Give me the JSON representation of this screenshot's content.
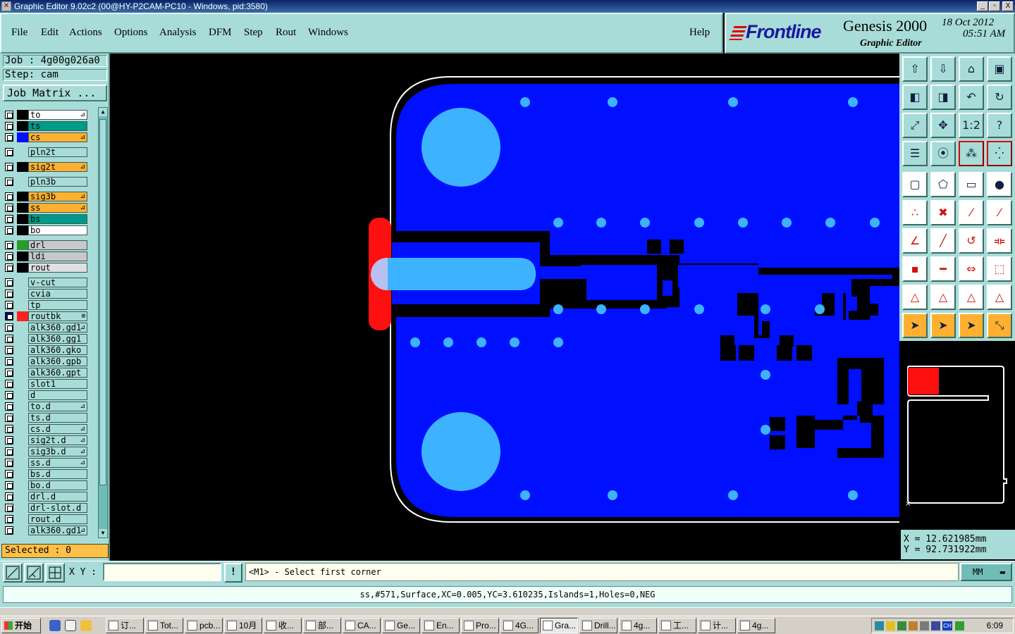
{
  "window": {
    "title": "Graphic Editor 9.02c2 (00@HY-P2CAM-PC10 - Windows, pid:3580)",
    "controls": [
      "_",
      "▫",
      "X"
    ]
  },
  "menu": {
    "items": [
      "File",
      "Edit",
      "Actions",
      "Options",
      "Analysis",
      "DFM",
      "Step",
      "Rout",
      "Windows"
    ],
    "help": "Help"
  },
  "brand": {
    "logo": "Frontline",
    "product": "Genesis 2000",
    "subtitle": "Graphic Editor",
    "date": "18 Oct 2012",
    "time": "05:51 AM"
  },
  "job": {
    "job_text": "Job : 4g00g026a0",
    "step_text": "Step: cam",
    "matrix_label": "Job Matrix ..."
  },
  "layers": [
    {
      "name": "to",
      "color": "#ffffff",
      "swatch": "#000000",
      "flag": "⊿"
    },
    {
      "name": "ts",
      "color": "#009a88",
      "swatch": "#000000",
      "flag": ""
    },
    {
      "name": "cs",
      "color": "#ffb030",
      "swatch": "#0010ff",
      "flag": "⊿"
    },
    {
      "name": "pln2t",
      "color": "#a8dcd8",
      "swatch": "",
      "flag": ""
    },
    {
      "name": "sig2t",
      "color": "#ffb030",
      "swatch": "#000000",
      "flag": "⊿"
    },
    {
      "name": "pln3b",
      "color": "#a8dcd8",
      "swatch": "",
      "flag": ""
    },
    {
      "name": "sig3b",
      "color": "#ffb030",
      "swatch": "#000000",
      "flag": "⊿"
    },
    {
      "name": "ss",
      "color": "#ffb030",
      "swatch": "#000000",
      "flag": "⊿"
    },
    {
      "name": "bs",
      "color": "#009a88",
      "swatch": "#000000",
      "flag": ""
    },
    {
      "name": "bo",
      "color": "#ffffff",
      "swatch": "#000000",
      "flag": ""
    },
    {
      "name": "drl",
      "color": "#c8c8c8",
      "swatch": "#2a9a2a",
      "flag": ""
    },
    {
      "name": "ldi",
      "color": "#c8c8c8",
      "swatch": "#000000",
      "flag": ""
    },
    {
      "name": "rout",
      "color": "#e0e0e0",
      "swatch": "#000000",
      "flag": ""
    },
    {
      "name": "v-cut",
      "color": "#a8dcd8",
      "swatch": "",
      "flag": ""
    },
    {
      "name": "cvia",
      "color": "#a8dcd8",
      "swatch": "",
      "flag": ""
    },
    {
      "name": "tp",
      "color": "#a8dcd8",
      "swatch": "",
      "flag": ""
    },
    {
      "name": "routbk",
      "color": "#a8dcd8",
      "swatch": "#ff2020",
      "flag": "⊞"
    },
    {
      "name": "alk360.gd1",
      "color": "#a8dcd8",
      "swatch": "",
      "flag": "⊿"
    },
    {
      "name": "alk360.gg1",
      "color": "#a8dcd8",
      "swatch": "",
      "flag": ""
    },
    {
      "name": "alk360.gko",
      "color": "#a8dcd8",
      "swatch": "",
      "flag": ""
    },
    {
      "name": "alk360.gpb",
      "color": "#a8dcd8",
      "swatch": "",
      "flag": ""
    },
    {
      "name": "alk360.gpt",
      "color": "#a8dcd8",
      "swatch": "",
      "flag": ""
    },
    {
      "name": "slot1",
      "color": "#a8dcd8",
      "swatch": "",
      "flag": ""
    },
    {
      "name": "d",
      "color": "#a8dcd8",
      "swatch": "",
      "flag": ""
    },
    {
      "name": "to.d",
      "color": "#a8dcd8",
      "swatch": "",
      "flag": "⊿"
    },
    {
      "name": "ts.d",
      "color": "#a8dcd8",
      "swatch": "",
      "flag": ""
    },
    {
      "name": "cs.d",
      "color": "#a8dcd8",
      "swatch": "",
      "flag": "⊿"
    },
    {
      "name": "sig2t.d",
      "color": "#a8dcd8",
      "swatch": "",
      "flag": "⊿"
    },
    {
      "name": "sig3b.d",
      "color": "#a8dcd8",
      "swatch": "",
      "flag": "⊿"
    },
    {
      "name": "ss.d",
      "color": "#a8dcd8",
      "swatch": "",
      "flag": "⊿"
    },
    {
      "name": "bs.d",
      "color": "#a8dcd8",
      "swatch": "",
      "flag": ""
    },
    {
      "name": "bo.d",
      "color": "#a8dcd8",
      "swatch": "",
      "flag": ""
    },
    {
      "name": "drl.d",
      "color": "#a8dcd8",
      "swatch": "",
      "flag": ""
    },
    {
      "name": "drl-slot.d",
      "color": "#a8dcd8",
      "swatch": "",
      "flag": ""
    },
    {
      "name": "rout.d",
      "color": "#a8dcd8",
      "swatch": "",
      "flag": ""
    },
    {
      "name": "alk360.gd1",
      "color": "#a8dcd8",
      "swatch": "",
      "flag": "⊿"
    }
  ],
  "selected_text": "Selected : 0",
  "coords": {
    "x_text": "X = 12.621985mm",
    "y_text": "Y = 92.731922mm"
  },
  "command": {
    "xy_label": "X Y :",
    "xy_value": "",
    "info_symbol": "!",
    "prompt": "<M1> - Select first corner",
    "units": "MM"
  },
  "status_text": "ss,#571,Surface,XC=0.005,YC=3.610235,Islands=1,Holes=0,NEG",
  "taskbar": {
    "start_label": "开始",
    "tasks": [
      "订...",
      "Tot...",
      "pcb...",
      "10月",
      "收...",
      "部...",
      "CA...",
      "Ge...",
      "En...",
      "Pro...",
      "4G...",
      "Gra...",
      "Drill...",
      "4g...",
      "工...",
      "计...",
      "4g..."
    ],
    "clock": "6:09",
    "tray_text": "CH"
  }
}
